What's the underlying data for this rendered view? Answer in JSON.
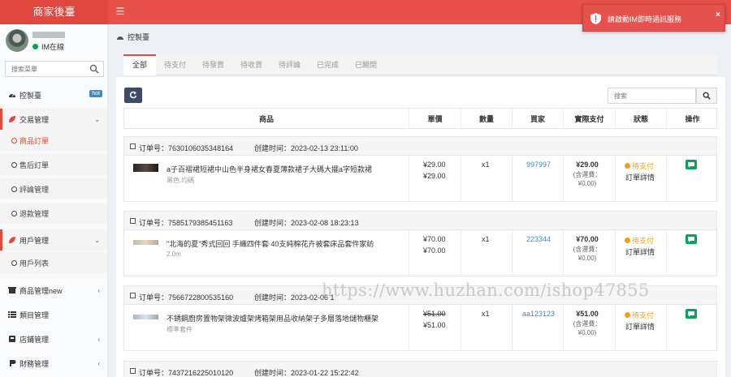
{
  "app": {
    "brand": "商家後臺"
  },
  "user": {
    "status": "IM在線"
  },
  "toast": {
    "message": "請啟動IM即時通訊服務"
  },
  "sidebar": {
    "search_placeholder": "搜索菜單",
    "items": [
      {
        "label": "控製臺",
        "badge": "hot"
      },
      {
        "label": "交易管理"
      },
      {
        "label": "用戶管理"
      },
      {
        "label": "商品管理new"
      },
      {
        "label": "類目管理"
      },
      {
        "label": "店鋪管理"
      },
      {
        "label": "財務管理"
      }
    ],
    "trade_sub": [
      "商品訂單",
      "售后訂單",
      "評論管理",
      "退款管理"
    ],
    "user_sub": [
      "用戶列表"
    ]
  },
  "breadcrumb": "控製臺",
  "tabs": [
    "全部",
    "待支付",
    "待發貨",
    "待收貨",
    "待評論",
    "已完成",
    "已關閉"
  ],
  "table": {
    "search_placeholder": "搜索",
    "headers": [
      "商品",
      "單價",
      "數量",
      "買家",
      "實際支付",
      "狀態",
      "操作"
    ]
  },
  "orders": [
    {
      "order_no": "订单号：7630106035348164",
      "created": "创建时间：2023-02-13 23:11:00",
      "product": "a子百褶裙短裙中山色半身裙女春夏薄款裙子大碼大擺a字短款裙",
      "spec": "黑色,均碼",
      "price_orig": "¥29.00",
      "price": "¥29.00",
      "qty": "x1",
      "buyer": "997997",
      "paid": "¥29.00",
      "paid_note_1": "(含運費：",
      "paid_note_2": "¥0.00)",
      "status": "待支付",
      "detail": "訂單詳情"
    },
    {
      "order_no": "订单号：7585179385451163",
      "created": "创建时间：2023-02-08 18:23:13",
      "product": "\"北海的夏\"秀式回回 手織四件套 40支純棉花卉被套床品套件家紡",
      "spec": "2.0m",
      "price_orig": "¥70.00",
      "price": "¥70.00",
      "qty": "x1",
      "buyer": "223344",
      "paid": "¥70.00",
      "paid_note_1": "(含運費：",
      "paid_note_2": "¥0.00)",
      "status": "待支付",
      "detail": "訂單詳情"
    },
    {
      "order_no": "订单号：7566722800535160",
      "created": "创建时间：2023-02-06 1",
      "product": "不銹鋼廚房置物架微波爐架烤箱架用品收納架子多層落地儲物櫃架",
      "spec": "標準套件",
      "price_orig": "¥51.00",
      "price": "¥51.00",
      "qty": "x1",
      "buyer": "aa123123",
      "paid": "¥51.00",
      "paid_note_1": "(含運費：",
      "paid_note_2": "¥0.00)",
      "status": "待支付",
      "detail": "訂單詳情"
    },
    {
      "order_no": "订单号：7437216225010120",
      "created": "创建时间：2023-01-22 15:22:42"
    }
  ],
  "watermark": "https://www.huzhan.com/ishop47855",
  "colors": {
    "topbar": "#e8504a",
    "accent": "#dd4b39",
    "link": "#3c8dbc",
    "pending": "#f39c12",
    "action": "#00a65a"
  }
}
